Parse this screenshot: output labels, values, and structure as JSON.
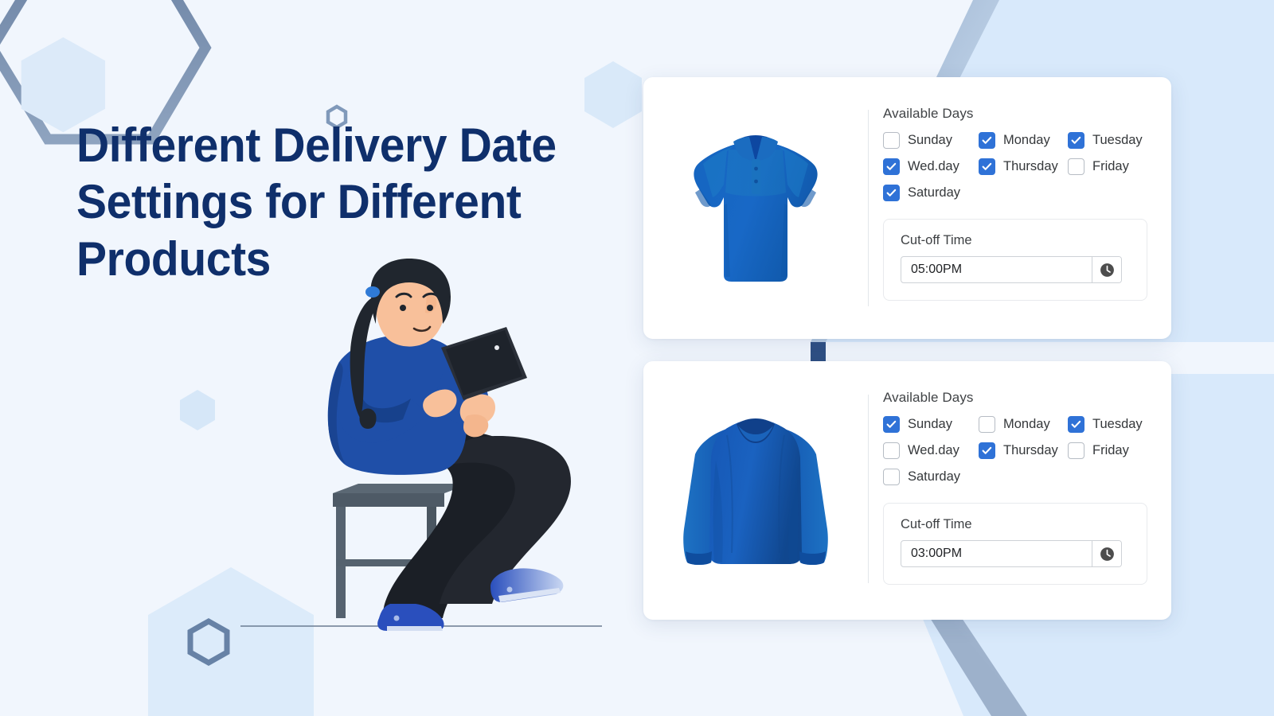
{
  "page": {
    "headline": "Different Delivery Date Settings for Different Products",
    "background_color": "#f1f6fd",
    "headline_color": "#0f2f6b",
    "accent_color": "#2f72d7",
    "band_color": "#d6e8fa",
    "band_edge_color": "#2f4f80"
  },
  "illustration": {
    "name": "woman-sitting-on-stool-with-tablet",
    "hair_color": "#20262e",
    "sweater_color": "#1f4fa8",
    "pants_color": "#1b1f26",
    "skin_color": "#f8c09a",
    "shoe_color": "#2a4fbd",
    "stool_color": "#4a5560"
  },
  "cards": [
    {
      "id": "card-1",
      "thumbnail": {
        "name": "polo-shirt-thumbnail",
        "alt": "Blue short sleeve polo shirt",
        "primary_color": "#1565c0",
        "accent_color": "#1e7ec8",
        "dark_color": "#0d47a1"
      },
      "available_days_label": "Available Days",
      "days": [
        {
          "label": "Sunday",
          "checked": false
        },
        {
          "label": "Monday",
          "checked": true
        },
        {
          "label": "Tuesday",
          "checked": true
        },
        {
          "label": "Wed.day",
          "checked": true
        },
        {
          "label": "Thursday",
          "checked": true
        },
        {
          "label": "Friday",
          "checked": false
        },
        {
          "label": "Saturday",
          "checked": true
        }
      ],
      "cutoff": {
        "label": "Cut-off Time",
        "value": "05:00PM",
        "icon": "clock-icon"
      }
    },
    {
      "id": "card-2",
      "thumbnail": {
        "name": "long-sleeve-shirt-thumbnail",
        "alt": "Blue long sleeve crew neck shirt",
        "primary_color": "#1657b5",
        "accent_color": "#1c6cc4",
        "dark_color": "#10408a"
      },
      "available_days_label": "Available Days",
      "days": [
        {
          "label": "Sunday",
          "checked": true
        },
        {
          "label": "Monday",
          "checked": false
        },
        {
          "label": "Tuesday",
          "checked": true
        },
        {
          "label": "Wed.day",
          "checked": false
        },
        {
          "label": "Thursday",
          "checked": true
        },
        {
          "label": "Friday",
          "checked": false
        },
        {
          "label": "Saturday",
          "checked": false
        }
      ],
      "cutoff": {
        "label": "Cut-off Time",
        "value": "03:00PM",
        "icon": "clock-icon"
      }
    }
  ],
  "decorations": {
    "hexagon_outline_large": "hexagon-outline-icon",
    "hexagon_outline_small_top": "hexagon-outline-icon",
    "hexagon_outline_small_bottom": "hexagon-outline-icon",
    "hexagon_filled_topleft": "hexagon-filled-icon",
    "hexagon_filled_mid": "hexagon-filled-icon",
    "hexagon_filled_center": "hexagon-filled-icon",
    "hexagon_filled_bottomleft": "hexagon-filled-icon",
    "ground_line": "ground-line"
  }
}
